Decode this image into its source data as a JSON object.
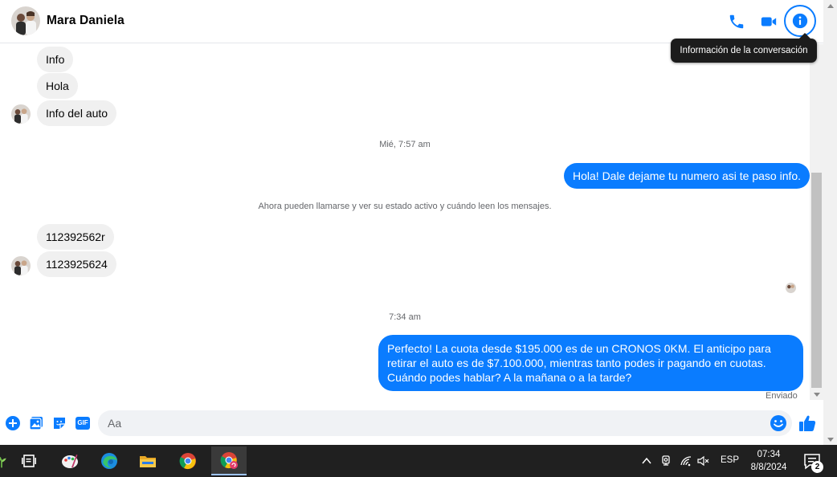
{
  "header": {
    "contact_name": "Mara Daniela",
    "tooltip": "Información de la conversación"
  },
  "messages": {
    "incoming_1": "Info",
    "incoming_2": "Hola",
    "incoming_3": "Info del auto",
    "timestamp_1": "Mié, 7:57 am",
    "outgoing_1": "Hola! Dale dejame tu numero  asi te paso info.",
    "system_note": "Ahora pueden llamarse y ver su estado activo y cuándo leen los mensajes.",
    "incoming_4": "112392562r",
    "incoming_5": "1123925624",
    "timestamp_2": "7:34 am",
    "outgoing_2": "Perfecto! La cuota desde $195.000 es de un CRONOS 0KM. El anticipo para retirar el auto es de $7.100.000, mientras tanto podes ir pagando en cuotas. Cuándo podes hablar? A la mañana o a la tarde?",
    "status": "Enviado"
  },
  "composer": {
    "placeholder": "Aa",
    "gif_label": "GIF"
  },
  "taskbar": {
    "language": "ESP",
    "time": "07:34",
    "date": "8/8/2024",
    "notifications": "2"
  },
  "colors": {
    "accent": "#0a7cff",
    "bubble_in": "#f0f0f0",
    "taskbar": "#202020"
  }
}
